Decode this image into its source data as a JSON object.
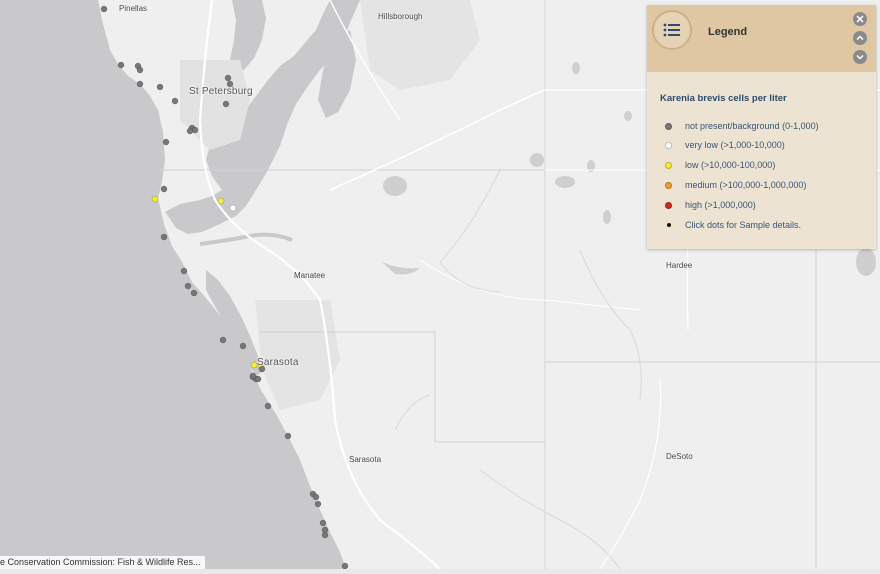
{
  "map": {
    "labels": [
      {
        "id": "pinellas",
        "text": "Pinellas",
        "kind": "county"
      },
      {
        "id": "hillsborough",
        "text": "Hillsborough",
        "kind": "county"
      },
      {
        "id": "st-petersburg",
        "text": "St Petersburg",
        "kind": "city"
      },
      {
        "id": "manatee",
        "text": "Manatee",
        "kind": "county"
      },
      {
        "id": "sarasota-city",
        "text": "Sarasota",
        "kind": "city"
      },
      {
        "id": "sarasota-county",
        "text": "Sarasota",
        "kind": "county"
      },
      {
        "id": "hardee",
        "text": "Hardee",
        "kind": "county"
      },
      {
        "id": "desoto",
        "text": "DeSoto",
        "kind": "county"
      }
    ],
    "sample_points": [
      {
        "level": "not-present"
      },
      {
        "level": "not-present"
      },
      {
        "level": "not-present"
      },
      {
        "level": "not-present"
      },
      {
        "level": "not-present"
      },
      {
        "level": "not-present"
      },
      {
        "level": "not-present"
      },
      {
        "level": "not-present"
      },
      {
        "level": "not-present"
      },
      {
        "level": "not-present"
      },
      {
        "level": "not-present"
      },
      {
        "level": "not-present"
      },
      {
        "level": "not-present"
      },
      {
        "level": "not-present"
      },
      {
        "level": "low"
      },
      {
        "level": "low"
      },
      {
        "level": "very-low"
      },
      {
        "level": "not-present"
      },
      {
        "level": "not-present"
      },
      {
        "level": "not-present"
      },
      {
        "level": "not-present"
      },
      {
        "level": "not-present"
      },
      {
        "level": "not-present"
      },
      {
        "level": "low"
      },
      {
        "level": "low"
      },
      {
        "level": "not-present"
      },
      {
        "level": "not-present"
      },
      {
        "level": "not-present"
      },
      {
        "level": "not-present"
      },
      {
        "level": "not-present"
      },
      {
        "level": "not-present"
      },
      {
        "level": "not-present"
      },
      {
        "level": "not-present"
      },
      {
        "level": "not-present"
      },
      {
        "level": "not-present"
      },
      {
        "level": "not-present"
      },
      {
        "level": "not-present"
      },
      {
        "level": "not-present"
      },
      {
        "level": "not-present"
      },
      {
        "level": "not-present"
      }
    ]
  },
  "legend": {
    "title": "Legend",
    "subtitle": "Karenia brevis cells per liter",
    "items": [
      {
        "label": "not present/background (0-1,000)",
        "color": "#7a7a7a"
      },
      {
        "label": "very low (>1,000-10,000)",
        "color": "#ffffff"
      },
      {
        "label": "low (>10,000-100,000)",
        "color": "#f6ee2c"
      },
      {
        "label": "medium (>100,000-1,000,000)",
        "color": "#f2a01f"
      },
      {
        "label": "high (>1,000,000)",
        "color": "#d7261e"
      },
      {
        "label": "Click dots for Sample details.",
        "color": "#111111"
      }
    ],
    "icons": {
      "menu": "list-icon",
      "close": "close-icon",
      "up": "chevron-up-icon",
      "down": "chevron-down-icon"
    }
  },
  "attribution": {
    "text": "e Conservation Commission: Fish & Wildlife Res..."
  }
}
